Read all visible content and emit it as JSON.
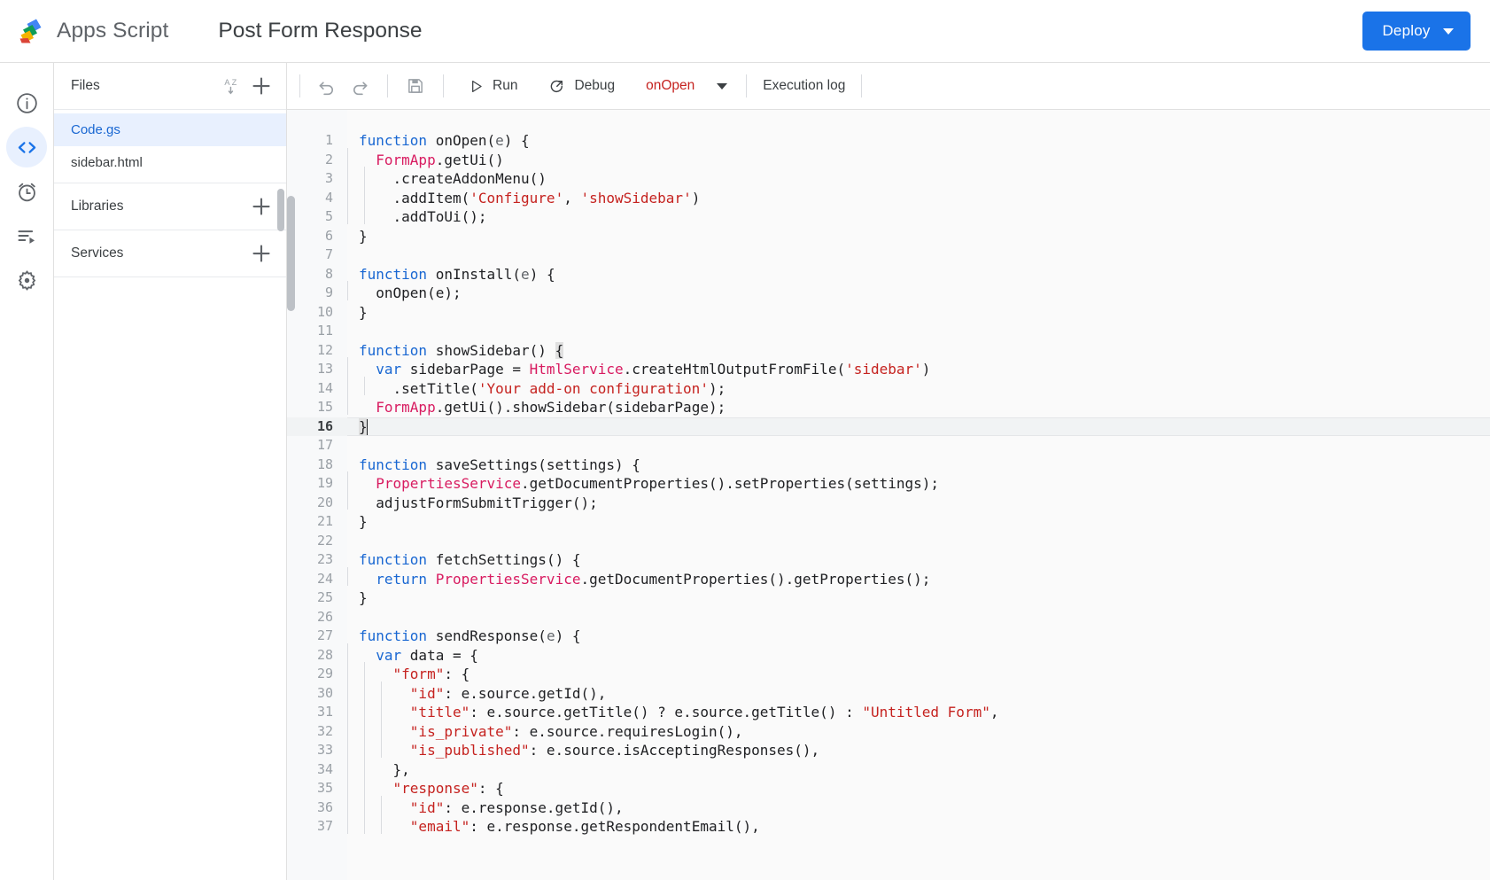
{
  "app": {
    "brand_name": "Apps Script",
    "logo_icon": "apps-script-logo",
    "project_title": "Post Form Response"
  },
  "topbar": {
    "deploy_label": "Deploy",
    "deploy_caret_icon": "chevron-down-icon",
    "accent_color": "#1a73e8"
  },
  "rail": {
    "items": [
      {
        "name": "overview",
        "icon": "info-circle-icon",
        "active": false
      },
      {
        "name": "editor",
        "icon": "code-brackets-icon",
        "active": true
      },
      {
        "name": "triggers",
        "icon": "alarm-clock-icon",
        "active": false
      },
      {
        "name": "executions",
        "icon": "execution-list-icon",
        "active": false
      },
      {
        "name": "settings",
        "icon": "gear-icon",
        "active": false
      }
    ]
  },
  "files_panel": {
    "files_header": {
      "title": "Files",
      "sort_icon": "sort-alpha-icon",
      "add_icon": "plus-icon"
    },
    "files": [
      {
        "label": "Code.gs",
        "selected": true
      },
      {
        "label": "sidebar.html",
        "selected": false
      }
    ],
    "libraries_header": {
      "title": "Libraries",
      "add_icon": "plus-icon"
    },
    "services_header": {
      "title": "Services",
      "add_icon": "plus-icon"
    }
  },
  "editor_toolbar": {
    "undo_icon": "undo-icon",
    "redo_icon": "redo-icon",
    "save_icon": "save-disk-icon",
    "run_label": "Run",
    "run_icon": "play-triangle-icon",
    "debug_label": "Debug",
    "debug_icon": "debug-bug-icon",
    "selected_function": "onOpen",
    "function_caret_icon": "chevron-down-icon",
    "execution_log_label": "Execution log"
  },
  "editor": {
    "active_line": 16,
    "total_visible_lines": 37,
    "lines": [
      {
        "n": 1,
        "tokens": [
          {
            "t": "function ",
            "c": "kw"
          },
          {
            "t": "onOpen",
            "c": "plain"
          },
          {
            "t": "(",
            "c": "plain"
          },
          {
            "t": "e",
            "c": "param"
          },
          {
            "t": ") {",
            "c": "plain"
          }
        ]
      },
      {
        "n": 2,
        "indent": 1,
        "tokens": [
          {
            "t": "  ",
            "c": "plain"
          },
          {
            "t": "FormApp",
            "c": "cls"
          },
          {
            "t": ".getUi()",
            "c": "plain"
          }
        ]
      },
      {
        "n": 3,
        "indent": 2,
        "tokens": [
          {
            "t": "    .createAddonMenu()",
            "c": "plain"
          }
        ]
      },
      {
        "n": 4,
        "indent": 2,
        "tokens": [
          {
            "t": "    .addItem(",
            "c": "plain"
          },
          {
            "t": "'Configure'",
            "c": "str"
          },
          {
            "t": ", ",
            "c": "plain"
          },
          {
            "t": "'showSidebar'",
            "c": "str"
          },
          {
            "t": ")",
            "c": "plain"
          }
        ]
      },
      {
        "n": 5,
        "indent": 2,
        "tokens": [
          {
            "t": "    .addToUi();",
            "c": "plain"
          }
        ]
      },
      {
        "n": 6,
        "tokens": [
          {
            "t": "}",
            "c": "plain"
          }
        ]
      },
      {
        "n": 7,
        "tokens": []
      },
      {
        "n": 8,
        "tokens": [
          {
            "t": "function ",
            "c": "kw"
          },
          {
            "t": "onInstall",
            "c": "plain"
          },
          {
            "t": "(",
            "c": "plain"
          },
          {
            "t": "e",
            "c": "param"
          },
          {
            "t": ") {",
            "c": "plain"
          }
        ]
      },
      {
        "n": 9,
        "indent": 1,
        "tokens": [
          {
            "t": "  onOpen(e);",
            "c": "plain"
          }
        ]
      },
      {
        "n": 10,
        "tokens": [
          {
            "t": "}",
            "c": "plain"
          }
        ]
      },
      {
        "n": 11,
        "tokens": []
      },
      {
        "n": 12,
        "tokens": [
          {
            "t": "function ",
            "c": "kw"
          },
          {
            "t": "showSidebar",
            "c": "plain"
          },
          {
            "t": "() ",
            "c": "plain"
          },
          {
            "t": "{",
            "c": "match"
          }
        ]
      },
      {
        "n": 13,
        "indent": 1,
        "tokens": [
          {
            "t": "  ",
            "c": "plain"
          },
          {
            "t": "var ",
            "c": "kw"
          },
          {
            "t": "sidebarPage = ",
            "c": "plain"
          },
          {
            "t": "HtmlService",
            "c": "cls"
          },
          {
            "t": ".createHtmlOutputFromFile(",
            "c": "plain"
          },
          {
            "t": "'sidebar'",
            "c": "str"
          },
          {
            "t": ")",
            "c": "plain"
          }
        ]
      },
      {
        "n": 14,
        "indent": 2,
        "tokens": [
          {
            "t": "    .setTitle(",
            "c": "plain"
          },
          {
            "t": "'Your add-on configuration'",
            "c": "str"
          },
          {
            "t": ");",
            "c": "plain"
          }
        ]
      },
      {
        "n": 15,
        "indent": 1,
        "tokens": [
          {
            "t": "  ",
            "c": "plain"
          },
          {
            "t": "FormApp",
            "c": "cls"
          },
          {
            "t": ".getUi().showSidebar(sidebarPage);",
            "c": "plain"
          }
        ]
      },
      {
        "n": 16,
        "active": true,
        "tokens": [
          {
            "t": "}",
            "c": "match"
          }
        ],
        "caret": true
      },
      {
        "n": 17,
        "tokens": []
      },
      {
        "n": 18,
        "tokens": [
          {
            "t": "function ",
            "c": "kw"
          },
          {
            "t": "saveSettings",
            "c": "plain"
          },
          {
            "t": "(settings) {",
            "c": "plain"
          }
        ]
      },
      {
        "n": 19,
        "indent": 1,
        "tokens": [
          {
            "t": "  ",
            "c": "plain"
          },
          {
            "t": "PropertiesService",
            "c": "cls"
          },
          {
            "t": ".getDocumentProperties().setProperties(settings);",
            "c": "plain"
          }
        ]
      },
      {
        "n": 20,
        "indent": 1,
        "tokens": [
          {
            "t": "  adjustFormSubmitTrigger();",
            "c": "plain"
          }
        ]
      },
      {
        "n": 21,
        "tokens": [
          {
            "t": "}",
            "c": "plain"
          }
        ]
      },
      {
        "n": 22,
        "tokens": []
      },
      {
        "n": 23,
        "tokens": [
          {
            "t": "function ",
            "c": "kw"
          },
          {
            "t": "fetchSettings",
            "c": "plain"
          },
          {
            "t": "() {",
            "c": "plain"
          }
        ]
      },
      {
        "n": 24,
        "indent": 1,
        "tokens": [
          {
            "t": "  ",
            "c": "plain"
          },
          {
            "t": "return ",
            "c": "kw"
          },
          {
            "t": "PropertiesService",
            "c": "cls"
          },
          {
            "t": ".getDocumentProperties().getProperties();",
            "c": "plain"
          }
        ]
      },
      {
        "n": 25,
        "tokens": [
          {
            "t": "}",
            "c": "plain"
          }
        ]
      },
      {
        "n": 26,
        "tokens": []
      },
      {
        "n": 27,
        "tokens": [
          {
            "t": "function ",
            "c": "kw"
          },
          {
            "t": "sendResponse",
            "c": "plain"
          },
          {
            "t": "(",
            "c": "plain"
          },
          {
            "t": "e",
            "c": "param"
          },
          {
            "t": ") {",
            "c": "plain"
          }
        ]
      },
      {
        "n": 28,
        "indent": 1,
        "tokens": [
          {
            "t": "  ",
            "c": "plain"
          },
          {
            "t": "var ",
            "c": "kw"
          },
          {
            "t": "data = {",
            "c": "plain"
          }
        ]
      },
      {
        "n": 29,
        "indent": 2,
        "tokens": [
          {
            "t": "    ",
            "c": "plain"
          },
          {
            "t": "\"form\"",
            "c": "prop"
          },
          {
            "t": ": {",
            "c": "plain"
          }
        ]
      },
      {
        "n": 30,
        "indent": 3,
        "tokens": [
          {
            "t": "      ",
            "c": "plain"
          },
          {
            "t": "\"id\"",
            "c": "prop"
          },
          {
            "t": ": e.source.getId(),",
            "c": "plain"
          }
        ]
      },
      {
        "n": 31,
        "indent": 3,
        "tokens": [
          {
            "t": "      ",
            "c": "plain"
          },
          {
            "t": "\"title\"",
            "c": "prop"
          },
          {
            "t": ": e.source.getTitle() ? e.source.getTitle() : ",
            "c": "plain"
          },
          {
            "t": "\"Untitled Form\"",
            "c": "str"
          },
          {
            "t": ",",
            "c": "plain"
          }
        ]
      },
      {
        "n": 32,
        "indent": 3,
        "tokens": [
          {
            "t": "      ",
            "c": "plain"
          },
          {
            "t": "\"is_private\"",
            "c": "prop"
          },
          {
            "t": ": e.source.requiresLogin(),",
            "c": "plain"
          }
        ]
      },
      {
        "n": 33,
        "indent": 3,
        "tokens": [
          {
            "t": "      ",
            "c": "plain"
          },
          {
            "t": "\"is_published\"",
            "c": "prop"
          },
          {
            "t": ": e.source.isAcceptingResponses(),",
            "c": "plain"
          }
        ]
      },
      {
        "n": 34,
        "indent": 2,
        "tokens": [
          {
            "t": "    },",
            "c": "plain"
          }
        ]
      },
      {
        "n": 35,
        "indent": 2,
        "tokens": [
          {
            "t": "    ",
            "c": "plain"
          },
          {
            "t": "\"response\"",
            "c": "prop"
          },
          {
            "t": ": {",
            "c": "plain"
          }
        ]
      },
      {
        "n": 36,
        "indent": 3,
        "tokens": [
          {
            "t": "      ",
            "c": "plain"
          },
          {
            "t": "\"id\"",
            "c": "prop"
          },
          {
            "t": ": e.response.getId(),",
            "c": "plain"
          }
        ]
      },
      {
        "n": 37,
        "indent": 3,
        "tokens": [
          {
            "t": "      ",
            "c": "plain"
          },
          {
            "t": "\"email\"",
            "c": "prop"
          },
          {
            "t": ": e.response.getRespondentEmail(),",
            "c": "plain"
          }
        ]
      }
    ]
  },
  "colors": {
    "keyword": "#1967d2",
    "class": "#d81b60",
    "string": "#c5221f",
    "plain": "#202124",
    "gutter_text": "#9aa0a6",
    "selected_file_bg": "#e8f0fe",
    "editor_bg": "#fafafa"
  }
}
